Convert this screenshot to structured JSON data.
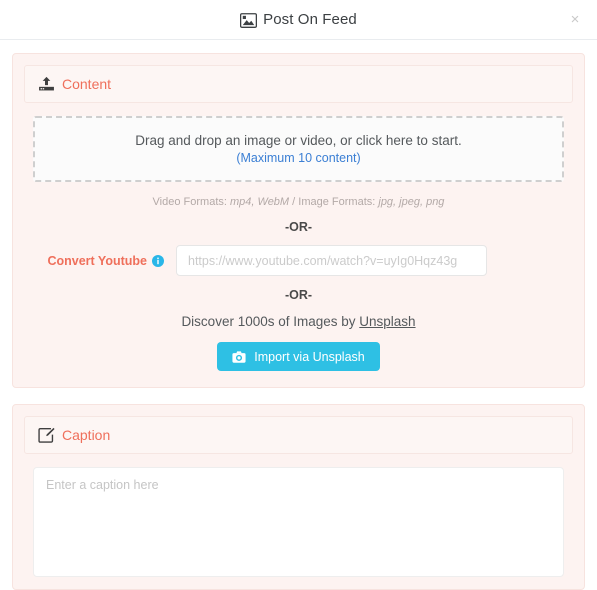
{
  "header": {
    "title": "Post On Feed",
    "title_icon": "image-icon",
    "close_label": "×"
  },
  "content_card": {
    "head": {
      "label": "Content",
      "icon": "upload-icon"
    },
    "dropzone": {
      "line1": "Drag and drop an image or video, or click here to start.",
      "line2": "(Maximum 10 content)"
    },
    "formats": {
      "video_prefix": "Video Formats:",
      "video_values": "mp4, WebM",
      "separator": "/",
      "image_prefix": "Image Formats:",
      "image_values": "jpg, jpeg, png"
    },
    "or_1": "-OR-",
    "youtube": {
      "label": "Convert Youtube",
      "info_icon": "info-icon",
      "placeholder": "https://www.youtube.com/watch?v=uyIg0Hqz43g",
      "value": ""
    },
    "or_2": "-OR-",
    "discover": {
      "text_before": "Discover 1000s of Images by ",
      "link": "Unsplash"
    },
    "unsplash_button": {
      "label": "Import via Unsplash",
      "icon": "camera-icon"
    }
  },
  "caption_card": {
    "head": {
      "label": "Caption",
      "icon": "edit-pencil-icon"
    },
    "textarea": {
      "placeholder": "Enter a caption here",
      "value": ""
    }
  },
  "colors": {
    "accent_salmon": "#ef6f5b",
    "card_bg": "#fdf3f1",
    "card_border": "#f7e3df",
    "link_blue": "#3b7fd4",
    "button_cyan": "#2ec0e4",
    "info_blue": "#29b6e8",
    "dropzone_border": "#cfcfcf"
  }
}
